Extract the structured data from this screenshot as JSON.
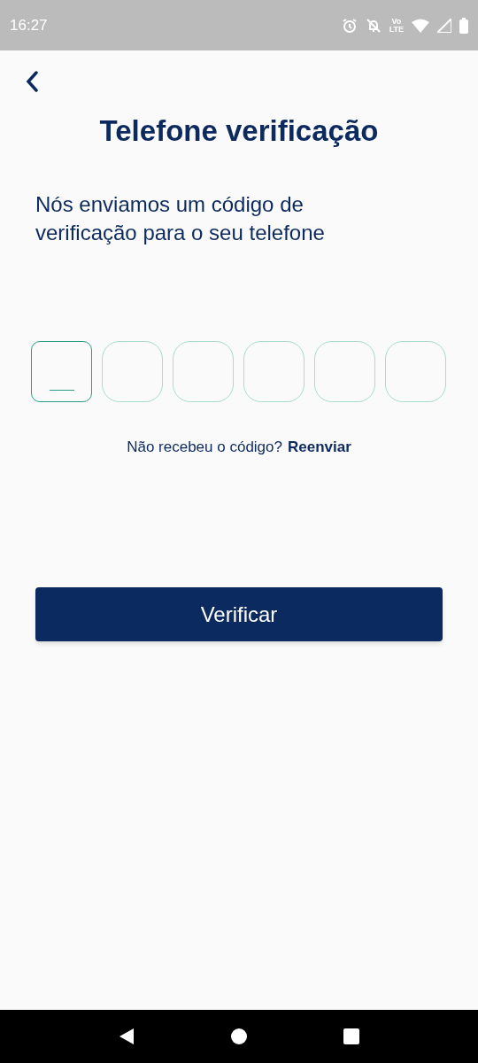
{
  "status_bar": {
    "time": "16:27",
    "network_top": "Vo",
    "network_bottom": "LTE"
  },
  "title": "Telefone verificação",
  "message": "Nós enviamos um código de verificação para o seu telefone",
  "code_boxes": [
    {
      "selected": true
    },
    {
      "selected": false
    },
    {
      "selected": false
    },
    {
      "selected": false
    },
    {
      "selected": false
    },
    {
      "selected": false
    }
  ],
  "resend_prompt": "Não recebeu o código?",
  "resend_link": "Reenviar",
  "verify_button": "Verificar"
}
